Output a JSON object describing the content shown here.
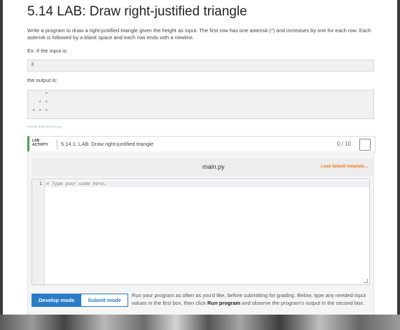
{
  "lab": {
    "title": "5.14 LAB: Draw right-justified triangle",
    "description": "Write a program to draw a right-justified triangle given the height as input. The first row has one asterisk (*) and increases by one for each row. Each asterisk is followed by a blank space and each row ends with a newline.",
    "example_label": "Ex: If the input is:",
    "example_input": "3",
    "output_label": "the output is:",
    "output_lines": [
      "    *",
      "  * *",
      "* * *"
    ],
    "activity_id": "599588.3482354.qx3zqy7"
  },
  "activity": {
    "tag_line1": "LAB",
    "tag_line2": "ACTIVITY",
    "title": "5.14.1: LAB: Draw right-justified triangle",
    "score": "0 / 10"
  },
  "editor": {
    "file_name": "main.py",
    "load_template": "Load default template...",
    "line_number": "1",
    "code": "# Type your code here."
  },
  "modes": {
    "develop": "Develop mode",
    "submit": "Submit mode"
  },
  "help": {
    "part1": "Run your program as often as you'd like, before submitting for grading. Below, type any needed input values in the first box, then click ",
    "run_bold": "Run program",
    "part2": " and observe the program's output in the second box."
  }
}
